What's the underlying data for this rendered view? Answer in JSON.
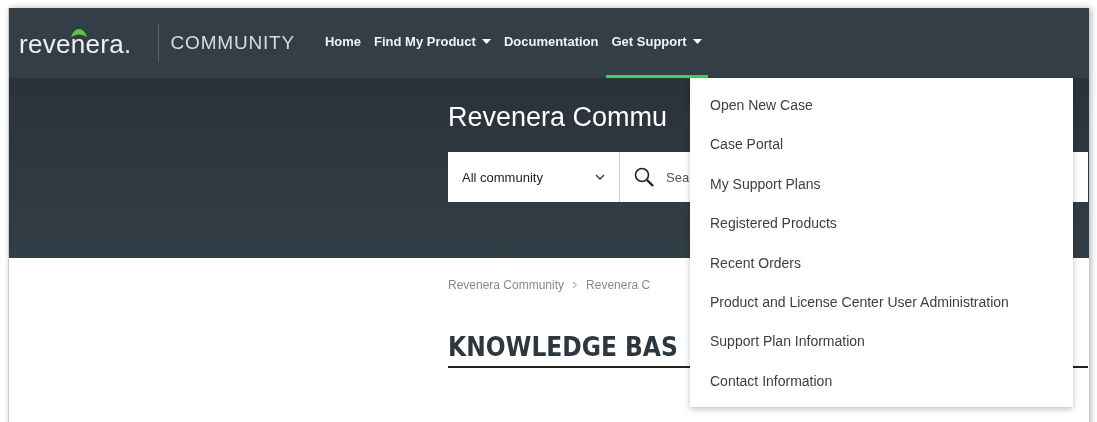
{
  "header": {
    "logo": "revenera.",
    "section": "COMMUNITY"
  },
  "nav": [
    {
      "label": "Home",
      "has_menu": false,
      "selected": false
    },
    {
      "label": "Find My Product",
      "has_menu": true,
      "selected": false
    },
    {
      "label": "Documentation",
      "has_menu": false,
      "selected": false
    },
    {
      "label": "Get Support",
      "has_menu": true,
      "selected": true
    }
  ],
  "hero": {
    "title": "Revenera Commu",
    "scope": "All community",
    "search_placeholder": "Sea"
  },
  "breadcrumb": [
    "Revenera Community",
    "Revenera C"
  ],
  "heading": "KNOWLEDGE BAS",
  "menu": [
    "Open New Case",
    "Case Portal",
    "My Support Plans",
    "Registered Products",
    "Recent Orders",
    "Product and License Center User Administration",
    "Support Plan Information",
    "Contact Information"
  ]
}
